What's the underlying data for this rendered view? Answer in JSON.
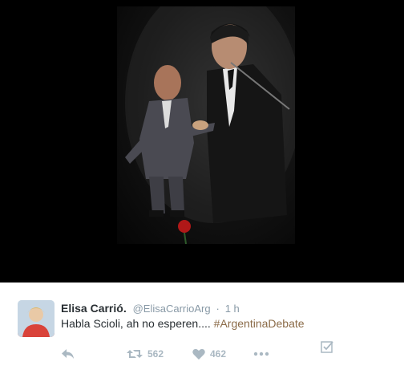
{
  "media": {
    "alt": "photo"
  },
  "tweet": {
    "author_name": "Elisa Carrió.",
    "author_handle": "@ElisaCarrioArg",
    "separator": "·",
    "time": "1 h",
    "text": "Habla Scioli, ah no esperen.... ",
    "hashtag": "#ArgentinaDebate"
  },
  "actions": {
    "reply_icon": "reply-icon",
    "retweet_icon": "retweet-icon",
    "retweet_count": "562",
    "like_icon": "heart-icon",
    "like_count": "462",
    "more_icon": "more-icon",
    "save_icon": "checkbox-icon"
  },
  "colors": {
    "handle": "#8899a6",
    "hashtag": "#8b6b48",
    "action": "#aab8c2",
    "media_bg": "#000000"
  }
}
